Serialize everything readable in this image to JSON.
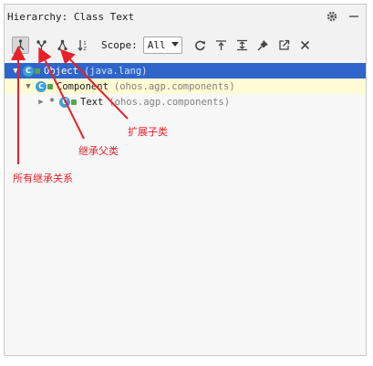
{
  "panel": {
    "title": "Hierarchy: Class Text",
    "title_actions": [
      {
        "icon": "gear-icon"
      },
      {
        "icon": "minimize-icon"
      }
    ]
  },
  "toolbar": {
    "buttons": [
      {
        "icon": "all-hierarchy-icon",
        "active": true
      },
      {
        "icon": "supertypes-icon",
        "active": false
      },
      {
        "icon": "subtypes-icon",
        "active": false
      },
      {
        "icon": "sort-alphabetically-icon",
        "active": false
      }
    ],
    "scope_label": "Scope:",
    "scope_value": "All",
    "right_buttons": [
      {
        "icon": "refresh-icon"
      },
      {
        "icon": "export-icon"
      },
      {
        "icon": "expand-all-icon"
      },
      {
        "icon": "pin-icon"
      },
      {
        "icon": "open-in-new-icon"
      },
      {
        "icon": "close-icon"
      }
    ]
  },
  "tree": [
    {
      "name": "Object",
      "package": "(java.lang)",
      "state": "selected"
    },
    {
      "name": "Component",
      "package": "(ohos.agp.components)",
      "state": "highlight"
    },
    {
      "name": "Text",
      "package": "(ohos.agp.components)",
      "state": "normal",
      "marker": "*"
    }
  ],
  "annotations": {
    "subtypes": "扩展子类",
    "supertypes": "继承父类",
    "all": "所有继承关系"
  },
  "colors": {
    "selection": "#2f65ca",
    "highlight": "#fffbd4",
    "annotation": "#e8202a",
    "class_icon": "#3f9fd8"
  }
}
